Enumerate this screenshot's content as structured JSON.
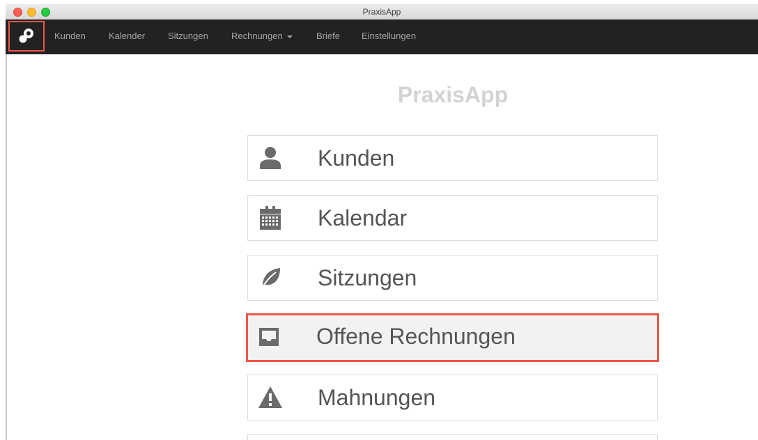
{
  "window": {
    "title": "PraxisApp"
  },
  "navbar": {
    "brand_icon": "app-logo-icon",
    "items": [
      {
        "label": "Kunden"
      },
      {
        "label": "Kalender"
      },
      {
        "label": "Sitzungen"
      },
      {
        "label": "Rechnungen",
        "dropdown": true
      },
      {
        "label": "Briefe"
      },
      {
        "label": "Einstellungen"
      }
    ]
  },
  "main": {
    "title": "PraxisApp",
    "tiles": [
      {
        "label": "Kunden",
        "icon": "user-icon"
      },
      {
        "label": "Kalendar",
        "icon": "calendar-icon"
      },
      {
        "label": "Sitzungen",
        "icon": "leaf-icon"
      },
      {
        "label": "Offene Rechnungen",
        "icon": "inbox-icon",
        "highlighted": true
      },
      {
        "label": "Mahnungen",
        "icon": "warning-icon"
      }
    ]
  },
  "colors": {
    "navbar_bg": "#222222",
    "highlight": "#f0564b",
    "icon": "#6b6b6b",
    "title": "#d3d3d3"
  }
}
